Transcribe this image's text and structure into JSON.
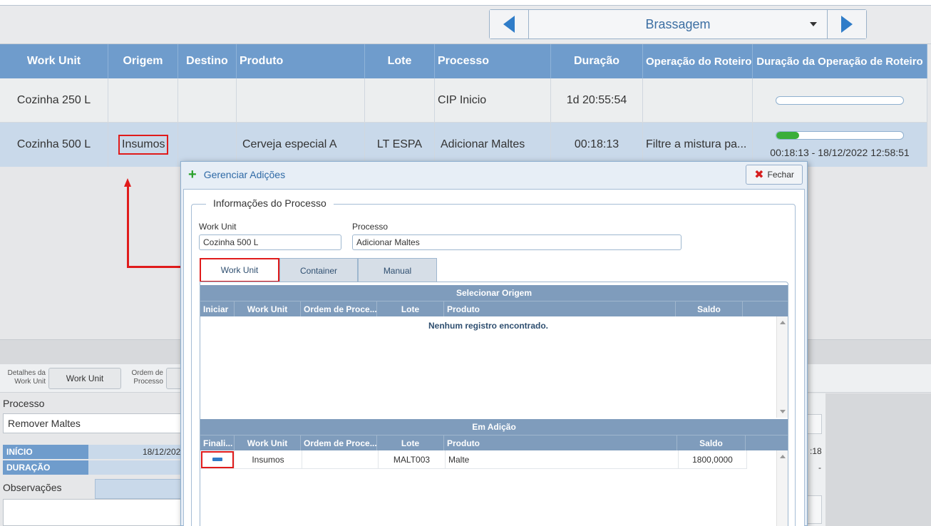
{
  "top_nav": {
    "selected": "Brassagem"
  },
  "grid": {
    "columns": [
      "Work Unit",
      "Origem",
      "Destino",
      "Produto",
      "Lote",
      "Processo",
      "Duração",
      "Operação do Roteiro",
      "Duração da Operação de Roteiro"
    ],
    "rows": [
      {
        "work_unit": "Cozinha 250 L",
        "origem": "",
        "destino": "",
        "produto": "",
        "lote": "",
        "processo": "CIP Inicio",
        "duracao": "1d 20:55:54",
        "operacao": "",
        "progress_fraction": 0.0,
        "progress_text": ""
      },
      {
        "work_unit": "Cozinha 500 L",
        "origem": "Insumos",
        "destino": "",
        "produto": "Cerveja especial A",
        "lote": "LT ESPA",
        "processo": "Adicionar Maltes",
        "duracao": "00:18:13",
        "operacao": "Filtre a mistura pa...",
        "progress_fraction": 0.18,
        "progress_text": "00:18:13 - 18/12/2022 12:58:51"
      }
    ]
  },
  "bottom_panel": {
    "detalhes_label_1": "Detalhes da",
    "detalhes_label_2": "Work Unit",
    "work_unit_button": "Work Unit",
    "ordem_label_1": "Ordem de",
    "ordem_label_2": "Processo",
    "processo_title": "Processo",
    "processo_value": "Remover Maltes",
    "inicio_label": "INÍCIO",
    "inicio_value": "18/12/2022",
    "duracao_label": "DURAÇÃO",
    "duracao_value": "",
    "observacoes_label": "Observações",
    "right_frag_1": ":18",
    "right_frag_2": "-"
  },
  "dialog": {
    "title": "Gerenciar Adições",
    "close_label": "Fechar",
    "legend": "Informações do Processo",
    "work_unit_label": "Work Unit",
    "work_unit_value": "Cozinha 500 L",
    "processo_label": "Processo",
    "processo_value": "Adicionar Maltes",
    "tabs": [
      "Work Unit",
      "Container",
      "Manual"
    ],
    "origem": {
      "title": "Selecionar Origem",
      "columns": [
        "Iniciar",
        "Work Unit",
        "Ordem de Proce...",
        "Lote",
        "Produto",
        "Saldo"
      ],
      "empty_message": "Nenhum registro encontrado."
    },
    "adicao": {
      "title": "Em Adição",
      "columns": [
        "Finali...",
        "Work Unit",
        "Ordem de Proce...",
        "Lote",
        "Produto",
        "Saldo"
      ],
      "rows": [
        {
          "work_unit": "Insumos",
          "ordem": "",
          "lote": "MALT003",
          "produto": "Malte",
          "saldo": "1800,0000"
        }
      ]
    }
  },
  "colors": {
    "header_blue": "#6f9ccc",
    "selected_row": "#c9d9ea",
    "annotation_red": "#e01b1b",
    "progress_green": "#3aae3a"
  }
}
